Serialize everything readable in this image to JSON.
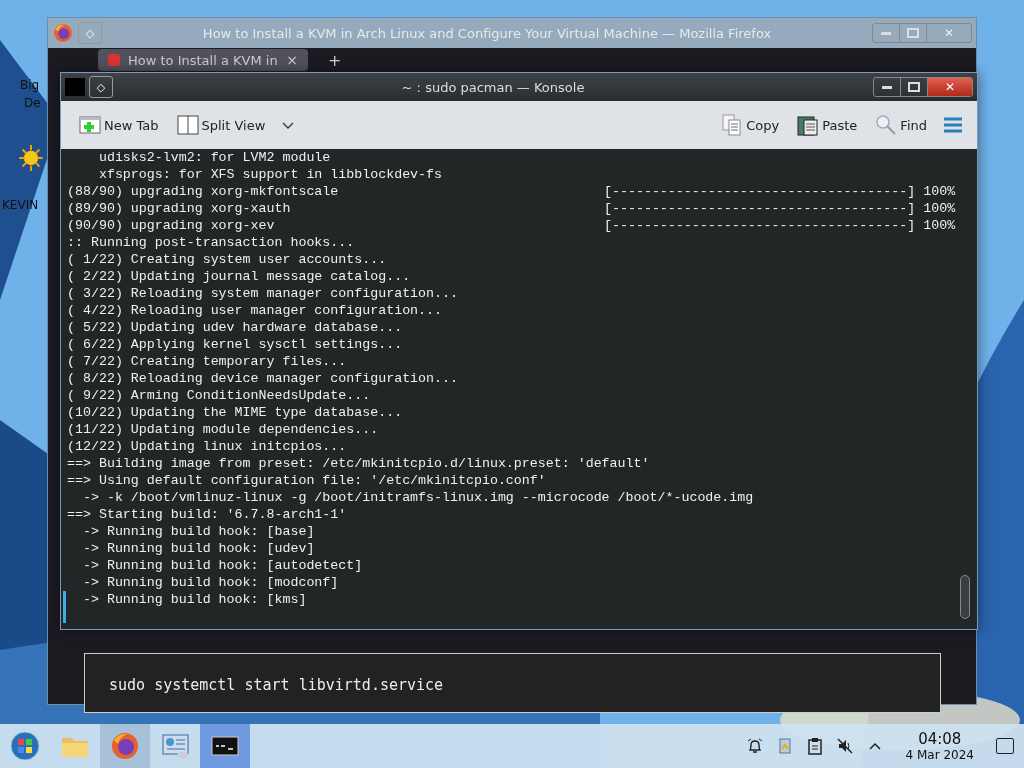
{
  "desktop": {
    "icons": [
      {
        "label": "Big"
      },
      {
        "label": "De"
      },
      {
        "label": "KEVIN"
      }
    ]
  },
  "browser_window": {
    "pin": "◇",
    "close": "✕",
    "title": "How to Install a KVM in Arch Linux and Configure Your Virtual Machine — Mozilla Firefox",
    "tabs": [
      {
        "label": "How to Install a KVM in",
        "close": "×",
        "selected": true
      }
    ],
    "new_tab": "+",
    "code_block": "sudo systemctl start libvirtd.service"
  },
  "terminal_window": {
    "pin": "◇",
    "close": "✕",
    "title": "~ : sudo pacman — Konsole",
    "toolbar": {
      "left": [
        {
          "kind": "newtab",
          "label": "New Tab"
        },
        {
          "kind": "split",
          "label": "Split View"
        }
      ],
      "right": [
        {
          "kind": "copy",
          "label": "Copy"
        },
        {
          "kind": "paste",
          "label": "Paste"
        },
        {
          "kind": "find",
          "label": "Find"
        }
      ]
    },
    "lines": [
      {
        "text": "    udisks2-lvm2: for LVM2 module"
      },
      {
        "text": "    xfsprogs: for XFS support in libblockdev-fs"
      },
      {
        "text": "(88/90) upgrading xorg-mkfontscale",
        "bar": "[-------------------------------------]",
        "percent": "100%"
      },
      {
        "text": "(89/90) upgrading xorg-xauth",
        "bar": "[-------------------------------------]",
        "percent": "100%"
      },
      {
        "text": "(90/90) upgrading xorg-xev",
        "bar": "[-------------------------------------]",
        "percent": "100%"
      },
      {
        "text": ":: Running post-transaction hooks..."
      },
      {
        "text": "( 1/22) Creating system user accounts..."
      },
      {
        "text": "( 2/22) Updating journal message catalog..."
      },
      {
        "text": "( 3/22) Reloading system manager configuration..."
      },
      {
        "text": "( 4/22) Reloading user manager configuration..."
      },
      {
        "text": "( 5/22) Updating udev hardware database..."
      },
      {
        "text": "( 6/22) Applying kernel sysctl settings..."
      },
      {
        "text": "( 7/22) Creating temporary files..."
      },
      {
        "text": "( 8/22) Reloading device manager configuration..."
      },
      {
        "text": "( 9/22) Arming ConditionNeedsUpdate..."
      },
      {
        "text": "(10/22) Updating the MIME type database..."
      },
      {
        "text": "(11/22) Updating module dependencies..."
      },
      {
        "text": "(12/22) Updating linux initcpios..."
      },
      {
        "text": "==> Building image from preset: /etc/mkinitcpio.d/linux.preset: 'default'"
      },
      {
        "text": "==> Using default configuration file: '/etc/mkinitcpio.conf'"
      },
      {
        "text": "  -> -k /boot/vmlinuz-linux -g /boot/initramfs-linux.img --microcode /boot/*-ucode.img"
      },
      {
        "text": "==> Starting build: '6.7.8-arch1-1'"
      },
      {
        "text": "  -> Running build hook: [base]"
      },
      {
        "text": "  -> Running build hook: [udev]"
      },
      {
        "text": "  -> Running build hook: [autodetect]"
      },
      {
        "text": "  -> Running build hook: [modconf]"
      },
      {
        "text": "  -> Running build hook: [kms]"
      }
    ]
  },
  "taskbar": {
    "apps": [
      {
        "kind": "start",
        "selected": false
      },
      {
        "kind": "files",
        "selected": false
      },
      {
        "kind": "firefox",
        "selected": true
      },
      {
        "kind": "monitor",
        "selected": false
      },
      {
        "kind": "konsole",
        "selected": true
      }
    ],
    "tray": [
      {
        "kind": "bell"
      },
      {
        "kind": "clipboard"
      },
      {
        "kind": "notes"
      },
      {
        "kind": "muted"
      },
      {
        "kind": "caret"
      }
    ],
    "time": "04:08",
    "date": "4 Mar 2024"
  }
}
